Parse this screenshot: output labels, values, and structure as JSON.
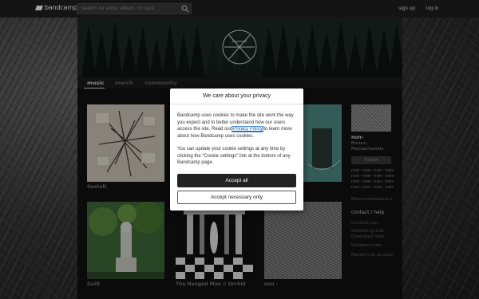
{
  "topbar": {
    "logo_text": "bandcamp",
    "search_placeholder": "Search for artist, album, or track",
    "signup": "sign up",
    "login": "log in"
  },
  "tabs": [
    {
      "label": "music",
      "active": true
    },
    {
      "label": "merch",
      "active": false
    },
    {
      "label": "community",
      "active": false
    }
  ],
  "albums": [
    {
      "title": "Gestalt"
    },
    {
      "title": ""
    },
    {
      "title": ""
    },
    {
      "title": "Guilt"
    },
    {
      "title": "The Hanged Man // Orchid"
    },
    {
      "title": "non -"
    }
  ],
  "sidebar": {
    "artist_name": "non-",
    "location_line1": "Boston,",
    "location_line2": "Massachusetts",
    "follow": "Follow",
    "bio_lines": [
      "non- non- non- non-",
      "non- non- non- non-",
      "non- non- non- non-",
      "non- non- non- non-"
    ],
    "recommendations": "Recommendations",
    "contact": "contact / help",
    "links": [
      "Contact non-",
      "Streaming and",
      "Download help",
      "Redeem code",
      "Report this account"
    ]
  },
  "modal": {
    "title": "We care about your privacy",
    "para1_before": "Bandcamp uses cookies to make the site work the way you expect and to better understand how our users access the site. Read our ",
    "para1_link": "Privacy Policy",
    "para1_after": " to learn more about how Bandcamp uses cookies.",
    "para2": "You can update your cookie settings at any time by clicking the “Cookie settings” link at the bottom of any Bandcamp page.",
    "accept_all": "Accept all",
    "accept_necessary": "Accept necessary only"
  }
}
